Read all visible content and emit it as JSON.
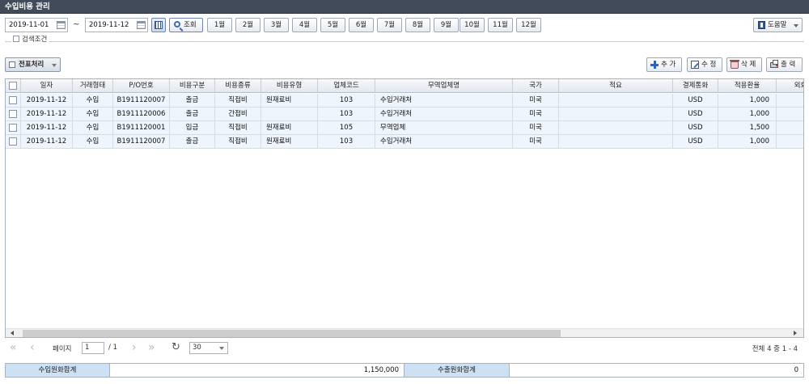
{
  "window": {
    "title": "수입비용 관리"
  },
  "search": {
    "date_from": "2019-11-01",
    "separator": "~",
    "date_to": "2019-11-12",
    "search_label": "조회",
    "months": [
      "1월",
      "2월",
      "3월",
      "4월",
      "5월",
      "6월",
      "7월",
      "8월",
      "9월",
      "10월",
      "11월",
      "12월"
    ],
    "help_label": "도움말",
    "filter_label": "검색조건"
  },
  "toolbar": {
    "process_label": "전표처리",
    "add_label": "추 가",
    "edit_label": "수 정",
    "delete_label": "삭 제",
    "print_label": "출 력"
  },
  "grid": {
    "columns": [
      "일자",
      "거래형태",
      "P/O번호",
      "비용구분",
      "비용종류",
      "비용유형",
      "업체코드",
      "무역업체명",
      "국가",
      "적요",
      "결제통화",
      "적용환율",
      "외화"
    ],
    "rows": [
      [
        "2019-11-12",
        "수입",
        "B1911120007",
        "출금",
        "직접비",
        "원재료비",
        "103",
        "수입거래처",
        "미국",
        "",
        "USD",
        "1,000"
      ],
      [
        "2019-11-12",
        "수입",
        "B1911120006",
        "출금",
        "간접비",
        "",
        "103",
        "수입거래처",
        "미국",
        "",
        "USD",
        "1,000"
      ],
      [
        "2019-11-12",
        "수입",
        "B1911120001",
        "입금",
        "직접비",
        "원재료비",
        "105",
        "무역업체",
        "미국",
        "",
        "USD",
        "1,500"
      ],
      [
        "2019-11-12",
        "수입",
        "B1911120007",
        "출금",
        "직접비",
        "원재료비",
        "103",
        "수입거래처",
        "미국",
        "",
        "USD",
        "1,000"
      ]
    ]
  },
  "pager": {
    "page_label": "페이지",
    "current_page": "1",
    "total_pages": "/ 1",
    "page_size": "30",
    "info": "전체 4 중 1 - 4"
  },
  "summary": {
    "import_label": "수입원화합계",
    "import_value": "1,150,000",
    "export_label": "수출원화합계",
    "export_value": "0"
  },
  "colors": {
    "titlebar": "#414b5a",
    "row_bg": "#eef5fc",
    "summary_label_bg": "#cde1f5"
  }
}
